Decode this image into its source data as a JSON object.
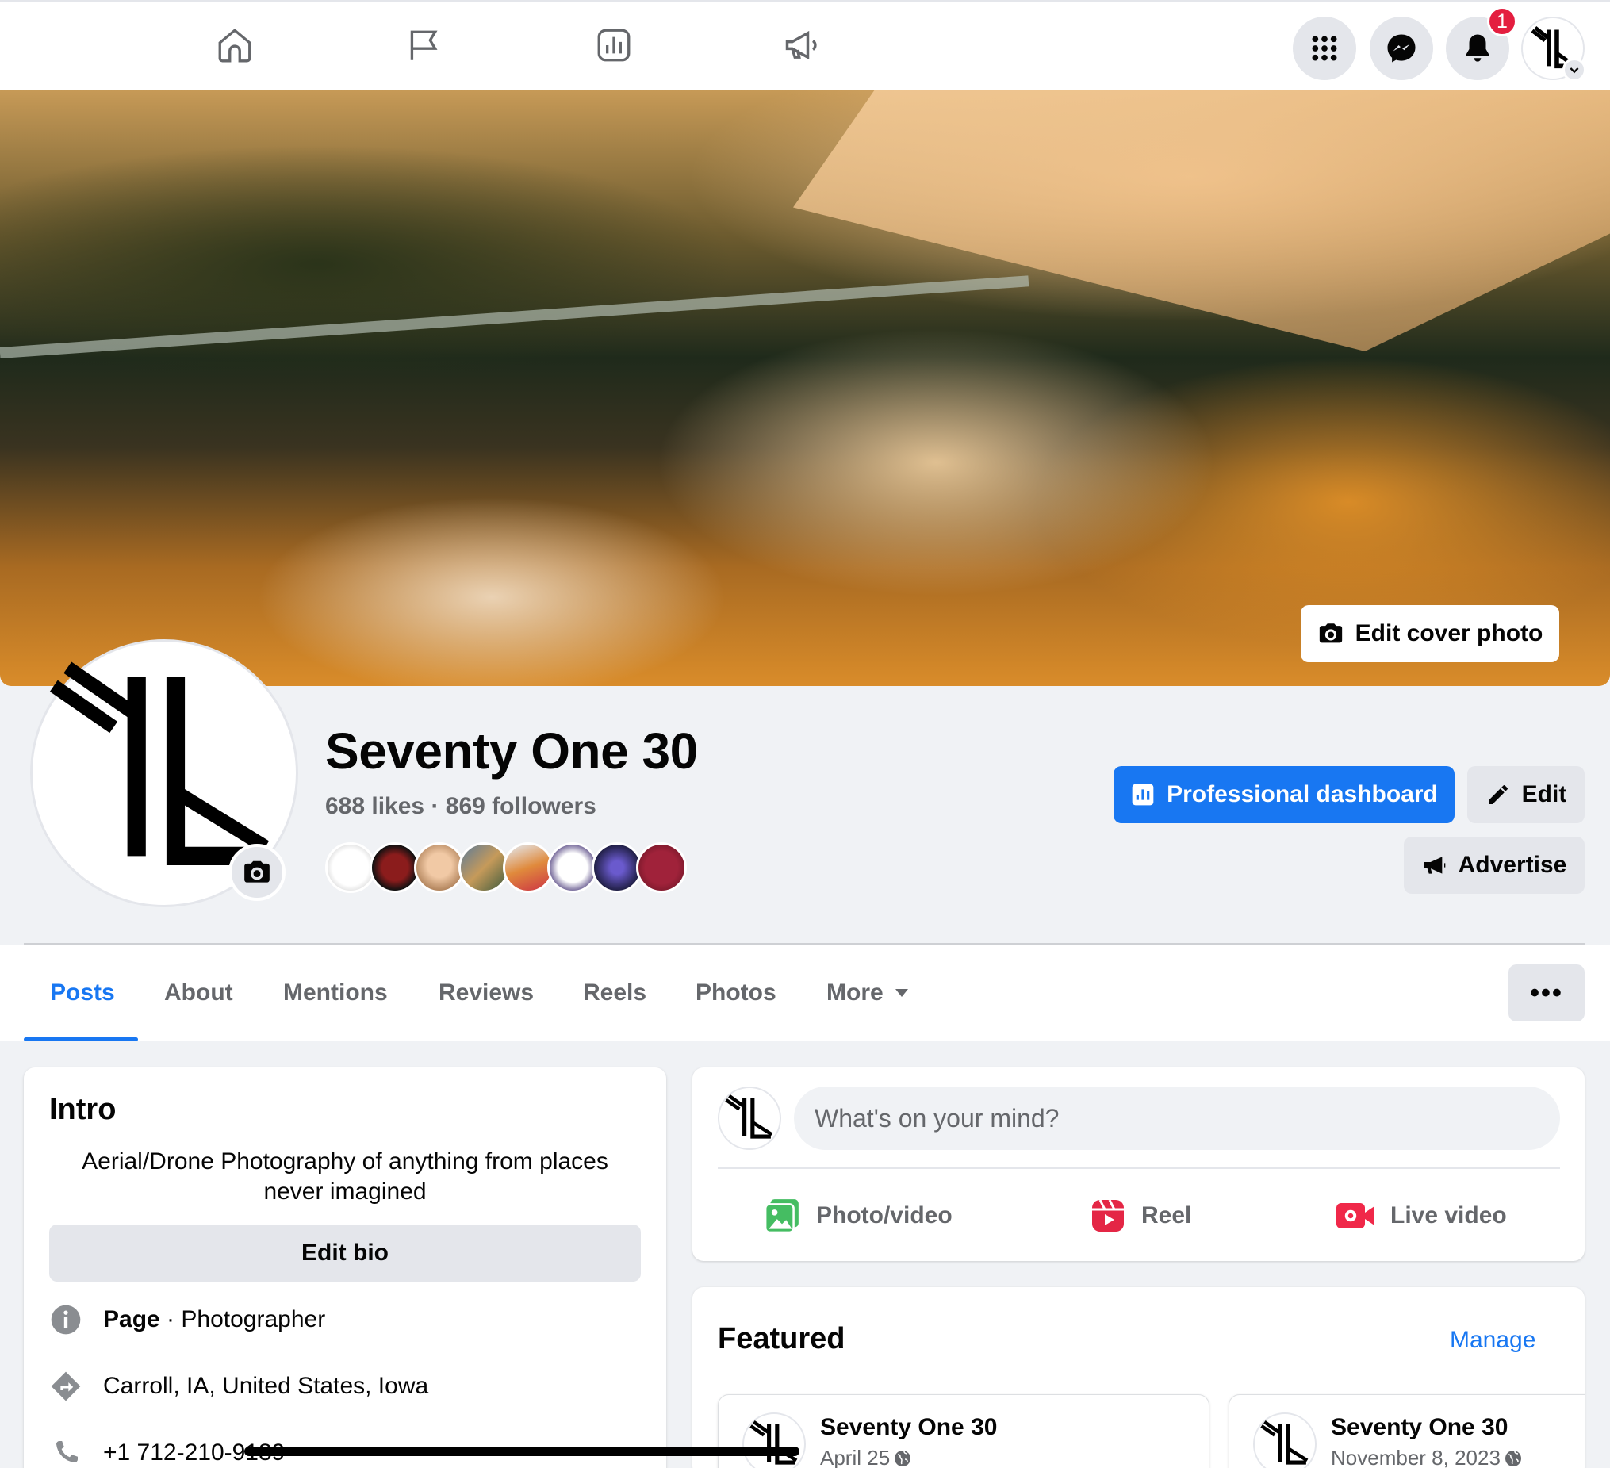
{
  "topbar": {
    "notification_count": "1",
    "nav_icons": [
      "home-icon",
      "flag-icon",
      "insights-icon",
      "megaphone-icon"
    ],
    "right_icons": [
      "menu-grid-icon",
      "messenger-icon",
      "bell-icon",
      "account-avatar"
    ]
  },
  "cover": {
    "edit_label": "Edit cover photo"
  },
  "profile": {
    "name": "Seventy One 30",
    "stats": "688 likes · 869 followers",
    "friend_avatar_count": 8
  },
  "actions": {
    "dashboard_label": "Professional dashboard",
    "edit_label": "Edit",
    "advertise_label": "Advertise"
  },
  "tabs": {
    "items": [
      {
        "label": "Posts",
        "active": true
      },
      {
        "label": "About"
      },
      {
        "label": "Mentions"
      },
      {
        "label": "Reviews"
      },
      {
        "label": "Reels"
      },
      {
        "label": "Photos"
      },
      {
        "label": "More"
      }
    ],
    "more_options": "•••"
  },
  "intro": {
    "title": "Intro",
    "bio": "Aerial/Drone Photography of anything from places never imagined",
    "edit_bio_label": "Edit bio",
    "category_strong": "Page",
    "category_rest": " · Photographer",
    "location": "Carroll, IA, United States, Iowa",
    "phone": "+1 712-210-9189"
  },
  "composer": {
    "placeholder": "What's on your mind?",
    "photo_label": "Photo/video",
    "reel_label": "Reel",
    "live_label": "Live video"
  },
  "featured": {
    "title": "Featured",
    "manage_label": "Manage",
    "posts": [
      {
        "name": "Seventy One 30",
        "date": "April 25"
      },
      {
        "name": "Seventy One 30",
        "date": "November 8, 2023"
      }
    ]
  },
  "colors": {
    "accent": "#1877f2",
    "badge": "#e41e3f",
    "photo_green": "#45bd62",
    "reel_pink": "#e42645",
    "live_red": "#f02849"
  }
}
